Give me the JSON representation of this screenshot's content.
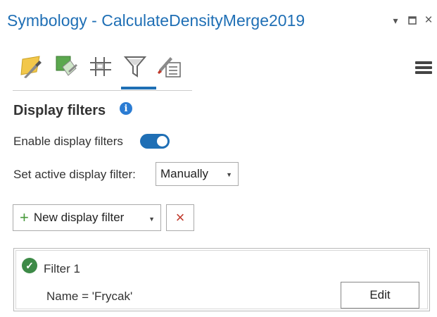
{
  "window": {
    "title": "Symbology - CalculateDensityMerge2019",
    "controls": [
      "dropdown-arrow",
      "maximize",
      "close"
    ]
  },
  "tabs": [
    {
      "name": "primary-symbology",
      "icon": "brush-polygon-icon"
    },
    {
      "name": "vary-symbology",
      "icon": "layered-polygon-icon"
    },
    {
      "name": "symbol-layer-drawing",
      "icon": "grid-icon"
    },
    {
      "name": "display-filters",
      "icon": "funnel-icon",
      "active": true
    },
    {
      "name": "symbology-properties",
      "icon": "brush-list-icon"
    }
  ],
  "section": {
    "heading": "Display filters",
    "enable_label": "Enable display filters",
    "enable_value": true,
    "active_filter_label": "Set active display filter:",
    "active_filter_value": "Manually"
  },
  "actions": {
    "new_filter_label": "New display filter",
    "delete_icon": "×"
  },
  "filter": {
    "name": "Filter 1",
    "expression": "Name = 'Frycak'",
    "edit_label": "Edit"
  },
  "colors": {
    "accent": "#1f6fb5",
    "success": "#3d8a47",
    "danger": "#c0392b"
  }
}
